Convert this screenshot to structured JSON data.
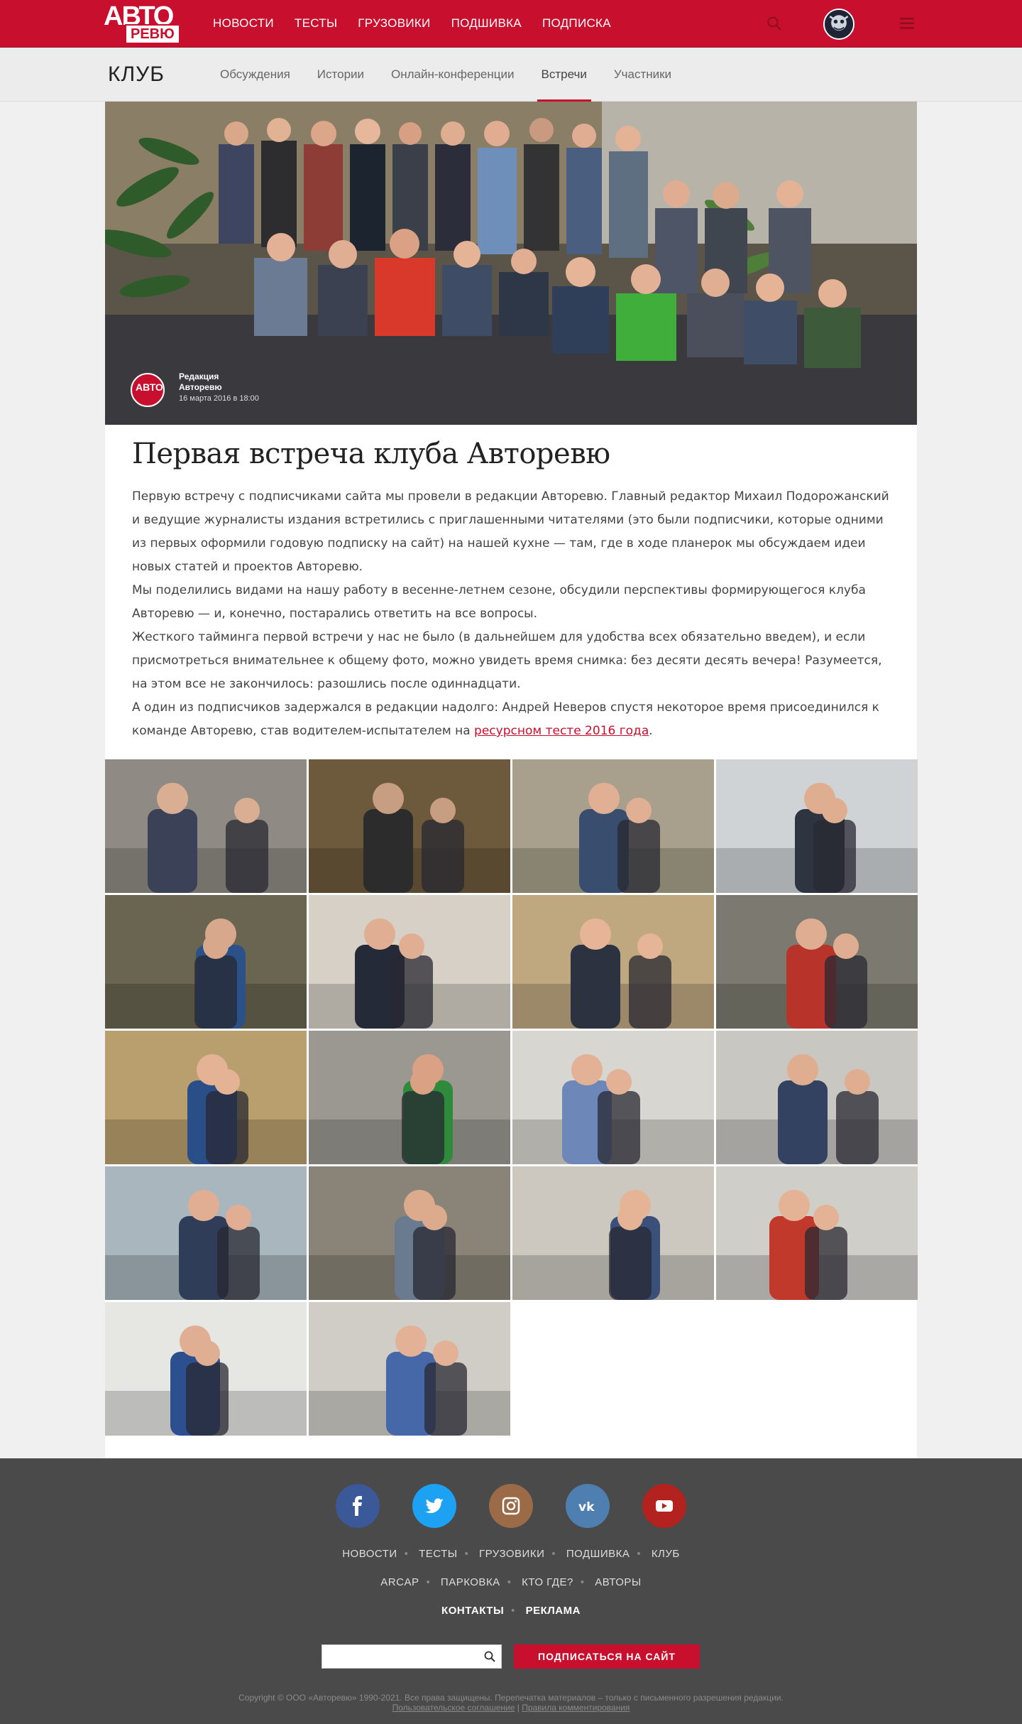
{
  "header": {
    "logo_top": "АВТО",
    "logo_bottom": "РЕВЮ",
    "nav": [
      "НОВОСТИ",
      "ТЕСТЫ",
      "ГРУЗОВИКИ",
      "ПОДШИВКА",
      "ПОДПИСКА"
    ],
    "accent": "#c8102e"
  },
  "subheader": {
    "title": "КЛУБ",
    "tabs": [
      "Обсуждения",
      "Истории",
      "Онлайн-конференции",
      "Встречи",
      "Участники"
    ],
    "active_tab": "Встречи"
  },
  "article": {
    "author": "Редакция Авторевю",
    "date": "16 марта 2016 в 18:00",
    "title": "Первая встреча клуба Авторевю",
    "p1": "Первую встречу с подписчиками сайта мы провели в редакции Авторевю. Главный редактор Михаил Подорожанский и ведущие журналисты издания встретились с приглашенными читателями (это были подписчики, которые одними из первых оформили годовую подписку на сайт) на нашей кухне — там, где в ходе планерок мы обсуждаем идеи новых статей и проектов Авторевю.",
    "p2": "Мы поделились видами на нашу работу в весенне-летнем сезоне, обсудили перспективы формирующегося клуба Авторевю — и, конечно, постарались ответить на все вопросы.",
    "p3": "Жесткого тайминга первой встречи у нас не было (в дальнейшем для удобства всех обязательно введем), и если присмотреться внимательнее к общему фото, можно увидеть время снимка: без десяти десять вечера! Разумеется, на этом все не закончилось: разошлись после одиннадцати.",
    "p4_start": "А один из подписчиков задержался в редакции надолго: Андрей Неверов спустя некоторое время присоединился к команде Авторевю, став водителем-испытателем на ",
    "p4_link": "ресурсном тесте 2016 года",
    "p4_end": "."
  },
  "gallery_count": 18,
  "footer": {
    "socials": [
      "facebook-icon",
      "twitter-icon",
      "instagram-icon",
      "vk-icon",
      "youtube-icon"
    ],
    "links1": [
      "НОВОСТИ",
      "ТЕСТЫ",
      "ГРУЗОВИКИ",
      "ПОДШИВКА",
      "КЛУБ"
    ],
    "links2": [
      "ARCAP",
      "ПАРКОВКА",
      "КТО ГДЕ?",
      "АВТОРЫ"
    ],
    "links3": [
      "КОНТАКТЫ",
      "РЕКЛАМА"
    ],
    "subscribe_label": "ПОДПИСАТЬСЯ НА САЙТ",
    "search_placeholder": "",
    "copyright": "Copyright © ООО «Авторевю» 1990-2021. Все права защищены. Перепечатка материалов – только с письменного разрешения редакции.",
    "terms": "Пользовательское соглашение",
    "rules": "Правила комментирования"
  }
}
